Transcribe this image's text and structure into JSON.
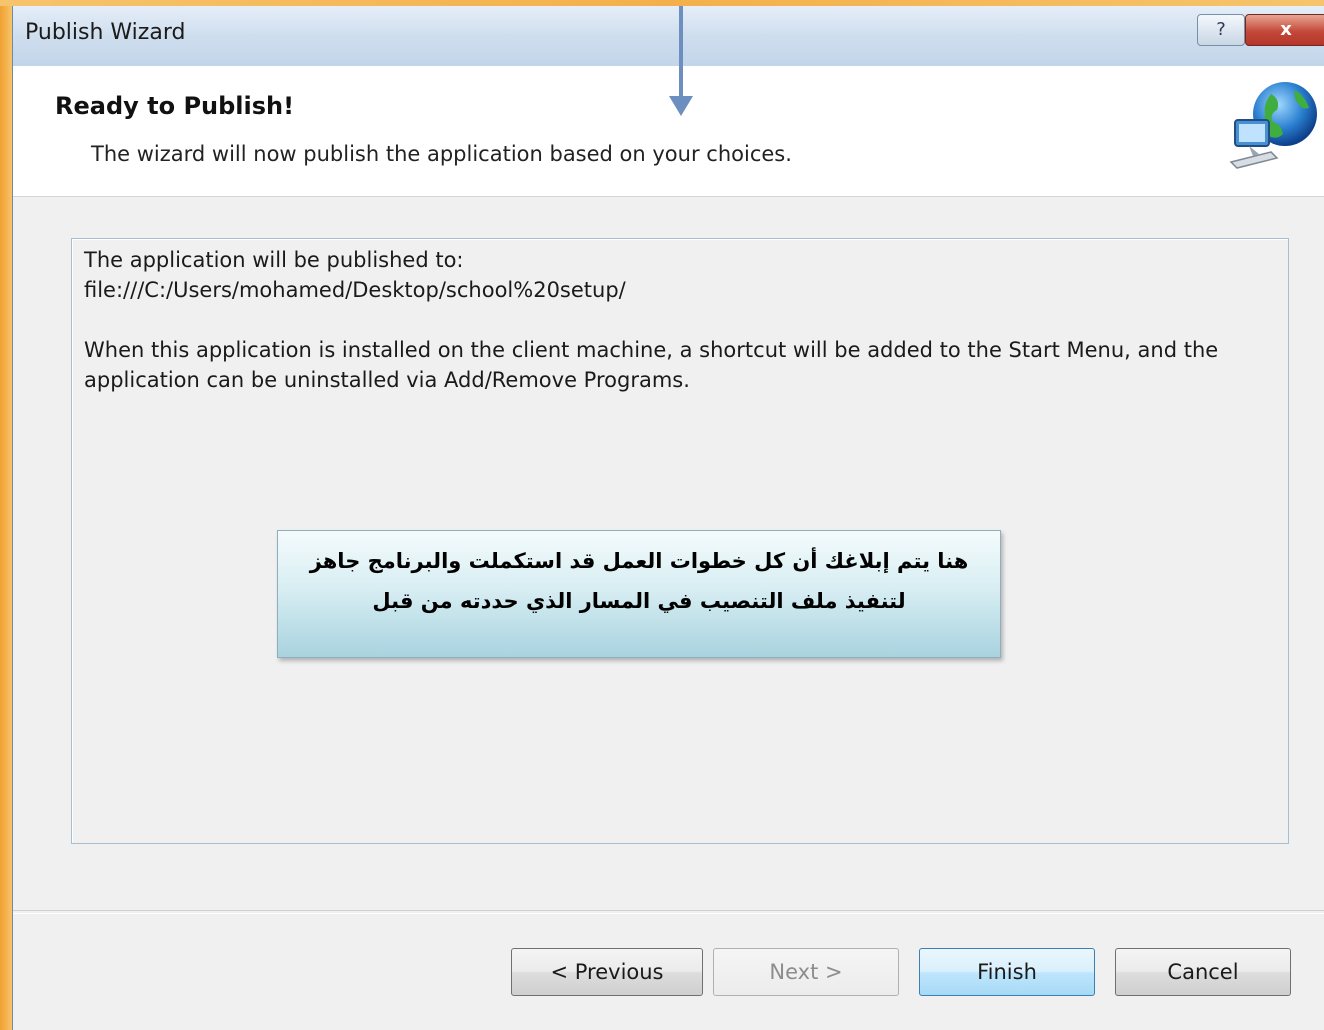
{
  "window": {
    "title": "Publish Wizard",
    "help_label": "?",
    "close_label": "x"
  },
  "header": {
    "title": "Ready to Publish!",
    "subtitle": "The wizard will now publish the application based on your choices.",
    "icon": "network-globe-icon"
  },
  "info": {
    "line1": "The application will be published to:",
    "line2": "file:///C:/Users/mohamed/Desktop/school%20setup/",
    "line3": "When this application is installed on the client machine, a shortcut will be added to the Start Menu, and the",
    "line4": "application can be uninstalled via Add/Remove Programs."
  },
  "callout": {
    "line1": "هنا يتم إبلاغك أن كل خطوات العمل قد استكملت والبرنامج جاهز",
    "line2": "لتنفيذ ملف التنصيب في المسار الذي حددته من قبل"
  },
  "buttons": {
    "previous": "< Previous",
    "next": "Next >",
    "finish": "Finish",
    "cancel": "Cancel"
  },
  "colors": {
    "frame": "#f3b04a",
    "arrow": "#6d8fbf",
    "close": "#c4493a"
  }
}
